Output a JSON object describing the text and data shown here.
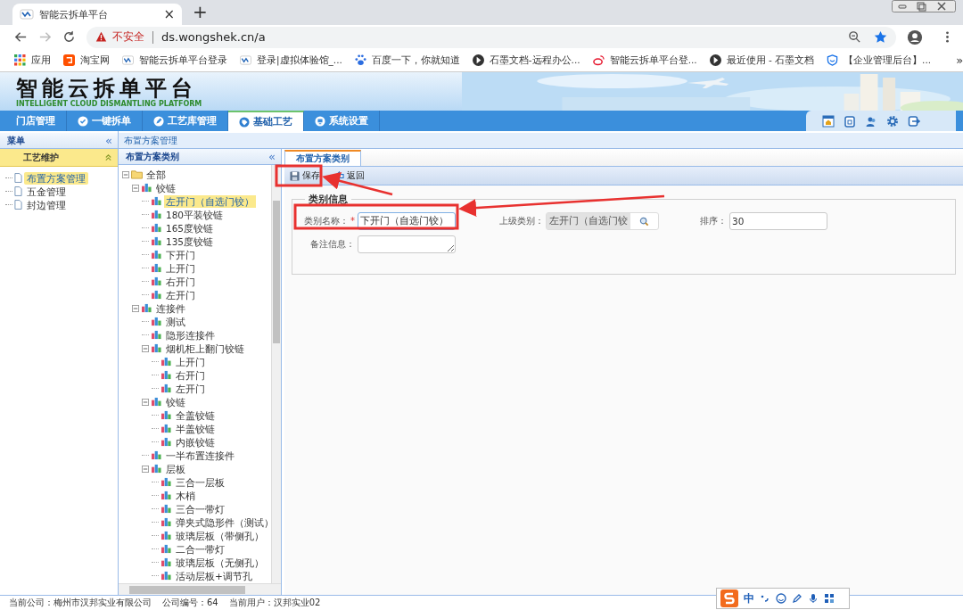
{
  "browser": {
    "tab_title": "智能云拆单平台",
    "close": "×",
    "new_tab": "+",
    "security": "不安全",
    "url": "ds.wongshek.cn/a",
    "more": "»",
    "bookmarks": [
      "应用",
      "淘宝网",
      "智能云拆单平台登录",
      "登录|虚拟体验馆_...",
      "百度一下，你就知道",
      "石墨文档-远程办公...",
      "智能云拆单平台登...",
      "最近使用 - 石墨文档",
      "【企业管理后台】..."
    ]
  },
  "app": {
    "title": "智能云拆单平台",
    "subtitle": "INTELLIGENT CLOUD DISMANTLING PLATFORM",
    "nav": [
      {
        "label": "门店管理",
        "selected": false
      },
      {
        "label": "一键拆单",
        "selected": false
      },
      {
        "label": "工艺库管理",
        "selected": false
      },
      {
        "label": "基础工艺",
        "selected": true
      },
      {
        "label": "系统设置",
        "selected": false
      }
    ]
  },
  "sidebar": {
    "title": "菜单",
    "collapse": "«",
    "section": {
      "label": "工艺维护",
      "expanded": true
    },
    "items": [
      {
        "label": "布置方案管理",
        "selected": true
      },
      {
        "label": "五金管理",
        "selected": false
      },
      {
        "label": "封边管理",
        "selected": false
      }
    ]
  },
  "breadcrumb": "布置方案管理",
  "tree_panel": {
    "title": "布置方案类别",
    "collapse": "«",
    "tree": [
      {
        "label": "全部",
        "selected": false,
        "expanded": true,
        "children": [
          {
            "label": "铰链",
            "selected": false,
            "expanded": true,
            "children": [
              {
                "label": "左开门（自选门铰）",
                "selected": true
              },
              {
                "label": "180平装铰链",
                "selected": false
              },
              {
                "label": "165度铰链",
                "selected": false
              },
              {
                "label": "135度铰链",
                "selected": false
              },
              {
                "label": "下开门",
                "selected": false
              },
              {
                "label": "上开门",
                "selected": false
              },
              {
                "label": "右开门",
                "selected": false
              },
              {
                "label": "左开门",
                "selected": false
              }
            ]
          },
          {
            "label": "连接件",
            "selected": false,
            "expanded": true,
            "children": [
              {
                "label": "测试",
                "selected": false
              },
              {
                "label": "隐形连接件",
                "selected": false
              },
              {
                "label": "烟机柜上翻门铰链",
                "selected": false,
                "expanded": true,
                "children": [
                  {
                    "label": "上开门",
                    "selected": false
                  },
                  {
                    "label": "右开门",
                    "selected": false
                  },
                  {
                    "label": "左开门",
                    "selected": false
                  }
                ]
              },
              {
                "label": "铰链",
                "selected": false,
                "expanded": true,
                "children": [
                  {
                    "label": "全盖铰链",
                    "selected": false
                  },
                  {
                    "label": "半盖铰链",
                    "selected": false
                  },
                  {
                    "label": "内嵌铰链",
                    "selected": false
                  }
                ]
              },
              {
                "label": "一半布置连接件",
                "selected": false
              },
              {
                "label": "层板",
                "selected": false,
                "expanded": true,
                "children": [
                  {
                    "label": "三合一层板",
                    "selected": false
                  },
                  {
                    "label": "木梢",
                    "selected": false
                  },
                  {
                    "label": "三合一带灯",
                    "selected": false
                  },
                  {
                    "label": "弹夹式隐形件（测试）",
                    "selected": false
                  },
                  {
                    "label": "玻璃层板（带侧孔）",
                    "selected": false
                  },
                  {
                    "label": "二合一带灯",
                    "selected": false
                  },
                  {
                    "label": "玻璃层板（无侧孔）",
                    "selected": false
                  },
                  {
                    "label": "活动层板+调节孔",
                    "selected": false
                  }
                ]
              }
            ]
          }
        ]
      }
    ]
  },
  "tabs": [
    {
      "label": "布置方案类别",
      "selected": true
    }
  ],
  "toolbar": [
    {
      "label": "保存",
      "kind": "save"
    },
    {
      "label": "返回",
      "kind": "back"
    }
  ],
  "form": {
    "legend": "类别信息",
    "required_mark": "*",
    "fields": [
      {
        "label": "类别名称：",
        "required": true,
        "kind": "text",
        "value": "下开门（自选门铰）"
      },
      {
        "label": "上级类别：",
        "required": false,
        "kind": "lookup",
        "value": "左开门（自选门铰"
      },
      {
        "label": "排序：",
        "required": false,
        "kind": "text",
        "value": "30"
      },
      {
        "label": "备注信息：",
        "required": false,
        "kind": "textarea"
      }
    ]
  },
  "status_bar": [
    "当前公司：梅州市汉邦实业有限公司",
    "公司编号：64",
    "当前用户：汉邦实业02"
  ],
  "ime": {
    "label": "中"
  }
}
